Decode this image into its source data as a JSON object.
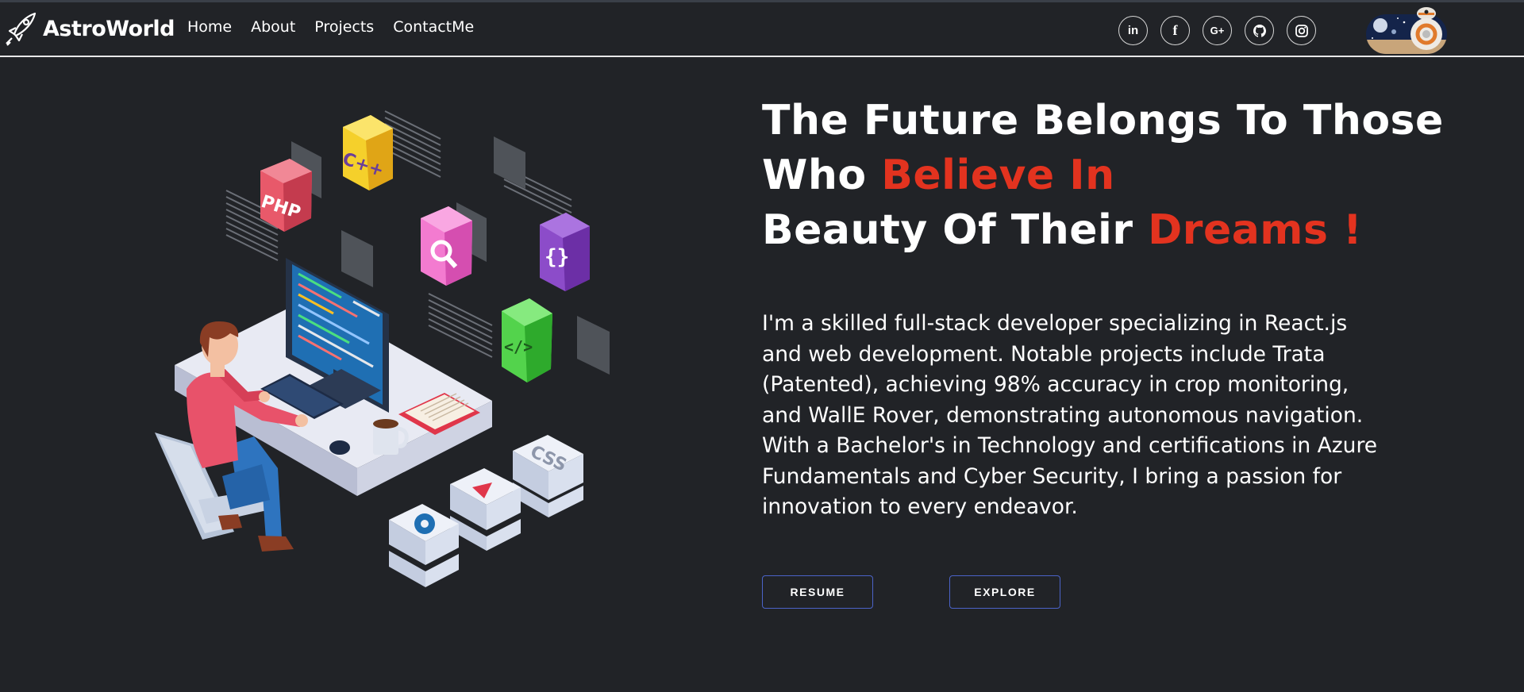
{
  "brand": {
    "name": "AstroWorld",
    "logo_icon": "rocket-icon"
  },
  "nav": {
    "items": [
      {
        "label": "Home"
      },
      {
        "label": "About"
      },
      {
        "label": "Projects"
      },
      {
        "label": "ContactMe"
      }
    ]
  },
  "socials": [
    {
      "icon": "linkedin-icon",
      "glyph": "in"
    },
    {
      "icon": "facebook-icon",
      "glyph": "f"
    },
    {
      "icon": "google-plus-icon",
      "glyph": "G+"
    },
    {
      "icon": "github-icon",
      "glyph": ""
    },
    {
      "icon": "instagram-icon",
      "glyph": ""
    }
  ],
  "hero": {
    "line1": "The Future Belongs To Those",
    "line2_a": "Who ",
    "line2_b": "Believe In",
    "line3_a": "Beauty Of Their ",
    "line3_b": "Dreams !",
    "description": "I'm a skilled full-stack developer specializing in React.js and web development. Notable projects include Trata (Patented), achieving 98% accuracy in crop monitoring, and WallE Rover, demonstrating autonomous navigation. With a Bachelor's in Technology and certifications in Azure Fundamentals and Cyber Security, I bring a passion for innovation to every endeavor."
  },
  "illustration": {
    "labels": {
      "php": "PHP",
      "cpp": "C++",
      "braces": "{}",
      "code": "</>",
      "css": "CSS"
    }
  },
  "buttons": {
    "resume": "RESUME",
    "explore": "EXPLORE"
  },
  "colors": {
    "background": "#212327",
    "accent": "#e3331f",
    "button_border": "#4b63c8"
  }
}
